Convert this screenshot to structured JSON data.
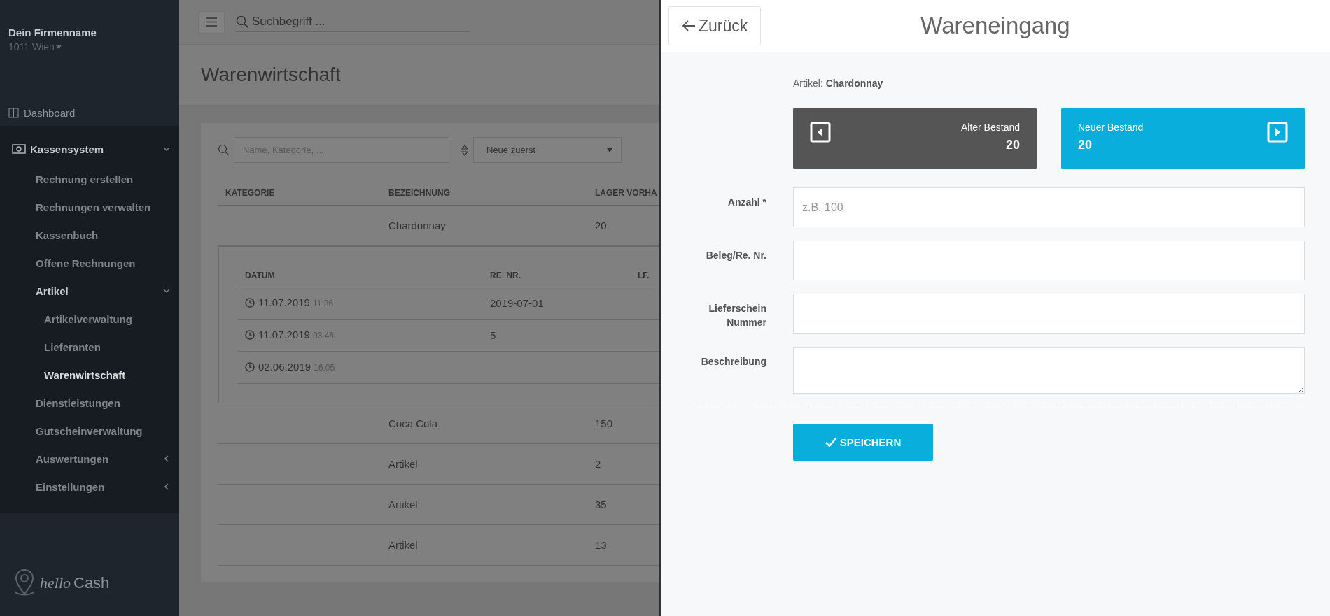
{
  "sidebar": {
    "company": "Dein Firmenname",
    "location": "1011 Wien",
    "items": [
      {
        "label": "Dashboard",
        "kind": "grid",
        "selected": false
      },
      {
        "label": "Kassensystem",
        "kind": "cash",
        "selected": false,
        "expanded": true,
        "children": [
          {
            "label": "Rechnung erstellen",
            "selected": false
          },
          {
            "label": "Rechnungen verwalten",
            "selected": false
          },
          {
            "label": "Kassenbuch",
            "selected": false
          },
          {
            "label": "Offene Rechnungen",
            "selected": false
          },
          {
            "label": "Artikel",
            "selected": false,
            "expanded": true,
            "children": [
              {
                "label": "Artikelverwaltung",
                "selected": false
              },
              {
                "label": "Lieferanten",
                "selected": false
              },
              {
                "label": "Warenwirtschaft",
                "selected": true
              }
            ]
          },
          {
            "label": "Dienstleistungen",
            "selected": false
          },
          {
            "label": "Gutscheinverwaltung",
            "selected": false
          },
          {
            "label": "Auswertungen",
            "selected": false,
            "expanded": false
          },
          {
            "label": "Einstellungen",
            "selected": false,
            "expanded": false
          }
        ]
      }
    ],
    "logo": {
      "first": "hello",
      "second": "Cash"
    }
  },
  "topbar": {
    "search_placeholder": "Suchbegriff ..."
  },
  "page_title": "Warenwirtschaft",
  "filter": {
    "placeholder": "Name, Kategorie, ...",
    "sort": "Neue zuerst"
  },
  "table": {
    "columns": [
      "KATEGORIE",
      "BEZEICHNUNG",
      "LAGER VORHA"
    ],
    "rows": [
      {
        "name": "Chardonnay",
        "stock": "20",
        "history": {
          "columns": [
            "DATUM",
            "RE. NR.",
            "LF."
          ],
          "rows": [
            {
              "date": "11.07.2019",
              "time": "11:36",
              "re_nr": "2019-07-01"
            },
            {
              "date": "11.07.2019",
              "time": "03:46",
              "re_nr": "5"
            },
            {
              "date": "02.06.2019",
              "time": "16:05"
            }
          ]
        }
      },
      {
        "name": "Coca Cola",
        "stock": "150"
      },
      {
        "name": "Artikel",
        "stock": "2"
      },
      {
        "name": "Artikel",
        "stock": "35"
      },
      {
        "name": "Artikel",
        "stock": "13"
      }
    ]
  },
  "panel": {
    "back": "Zurück",
    "title": "Wareneingang",
    "article": "Artikel: **Chardonnay**",
    "stock_cards": [
      {
        "kind": "old",
        "label": "Alter Bestand",
        "value": "20"
      },
      {
        "kind": "new",
        "label": "Neuer Bestand",
        "value": "20"
      }
    ],
    "fields": [
      {
        "kind": "input",
        "label": "Anzahl *",
        "placeholder": "z.B. 100"
      },
      {
        "kind": "input",
        "label": "Beleg/Re. Nr."
      },
      {
        "kind": "input",
        "label": "Lieferschein Nummer"
      },
      {
        "kind": "textarea",
        "label": "Beschreibung"
      }
    ],
    "save": "SPEICHERN"
  }
}
